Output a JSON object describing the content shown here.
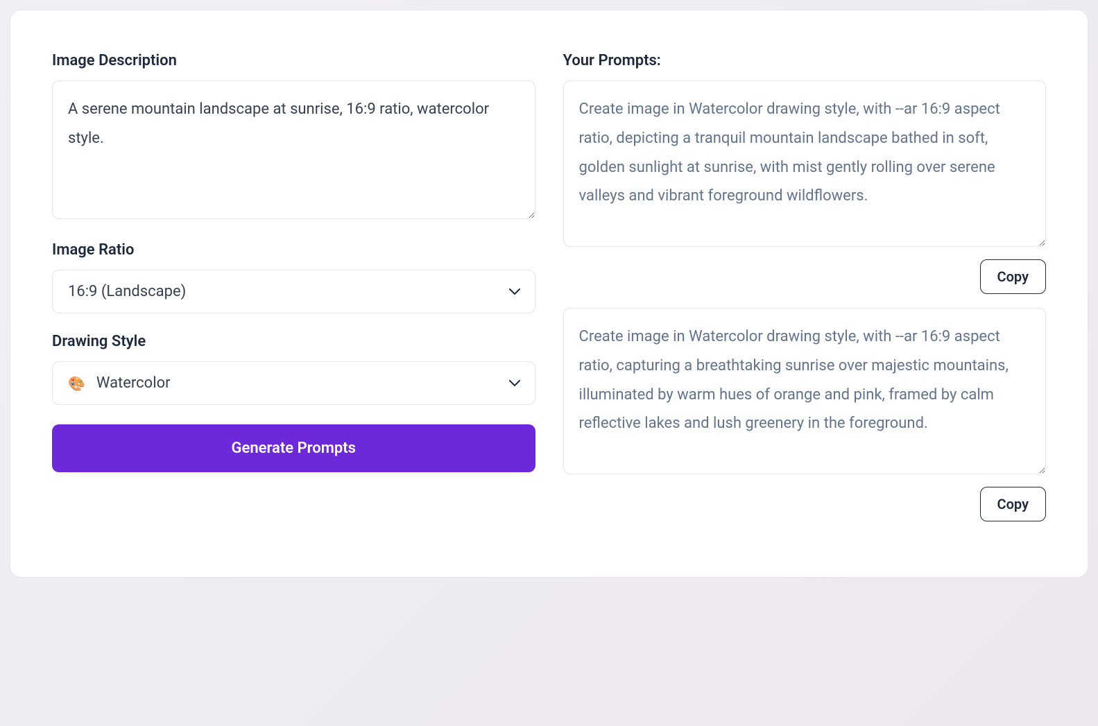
{
  "left": {
    "description_label": "Image Description",
    "description_value": "A serene mountain landscape at sunrise, 16:9 ratio, watercolor style.",
    "ratio_label": "Image Ratio",
    "ratio_value": "16:9 (Landscape)",
    "style_label": "Drawing Style",
    "style_value": "Watercolor",
    "style_icon": "🎨",
    "generate_label": "Generate Prompts"
  },
  "right": {
    "title": "Your Prompts:",
    "prompts": [
      {
        "text": "Create image in Watercolor drawing style, with --ar 16:9 aspect ratio, depicting a tranquil mountain landscape bathed in soft, golden sunlight at sunrise, with mist gently rolling over serene valleys and vibrant foreground wildflowers.",
        "copy_label": "Copy"
      },
      {
        "text": "Create image in Watercolor drawing style, with --ar 16:9 aspect ratio, capturing a breathtaking sunrise over majestic mountains, illuminated by warm hues of orange and pink, framed by calm reflective lakes and lush greenery in the foreground.",
        "copy_label": "Copy"
      }
    ]
  }
}
